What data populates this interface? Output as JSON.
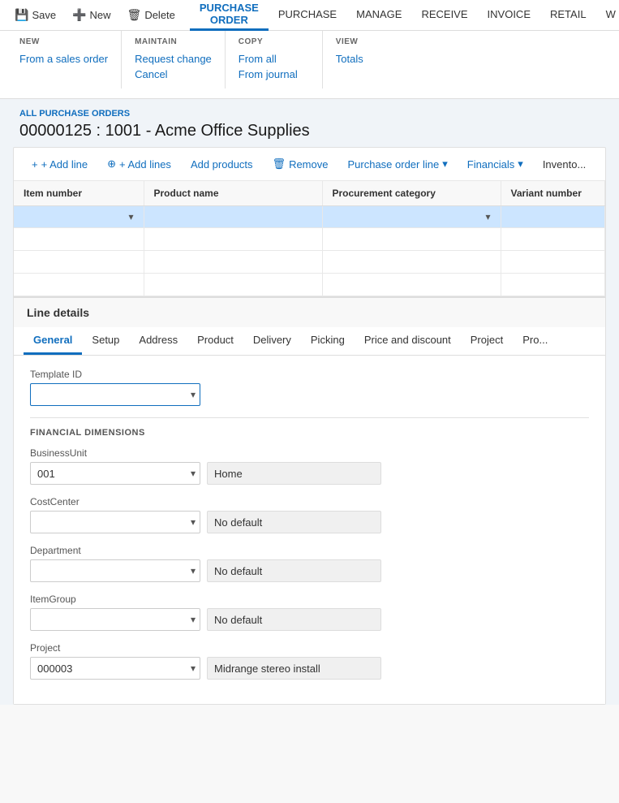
{
  "toolbar": {
    "save_label": "Save",
    "new_label": "New",
    "delete_label": "Delete",
    "tabs": [
      {
        "id": "purchase-order",
        "label": "PURCHASE ORDER",
        "active": true
      },
      {
        "id": "purchase",
        "label": "PURCHASE"
      },
      {
        "id": "manage",
        "label": "MANAGE"
      },
      {
        "id": "receive",
        "label": "RECEIVE"
      },
      {
        "id": "invoice",
        "label": "INVOICE"
      },
      {
        "id": "retail",
        "label": "RETAIL"
      },
      {
        "id": "w",
        "label": "W"
      }
    ]
  },
  "dropdown": {
    "new_section": {
      "title": "NEW",
      "items": [
        {
          "label": "From a sales order",
          "disabled": false
        }
      ]
    },
    "maintain_section": {
      "title": "MAINTAIN",
      "items": [
        {
          "label": "Request change",
          "disabled": false
        },
        {
          "label": "Cancel",
          "disabled": false
        }
      ]
    },
    "copy_section": {
      "title": "COPY",
      "items": [
        {
          "label": "From all",
          "disabled": false
        },
        {
          "label": "From journal",
          "disabled": false
        }
      ]
    },
    "view_section": {
      "title": "VIEW",
      "items": [
        {
          "label": "Totals",
          "disabled": false
        }
      ]
    }
  },
  "page_header": {
    "breadcrumb": "ALL PURCHASE ORDERS",
    "title": "00000125 : 1001 - Acme Office Supplies"
  },
  "grid_toolbar": {
    "add_line": "+ Add line",
    "add_lines": "+ Add lines",
    "add_products": "Add products",
    "remove": "Remove",
    "purchase_order_line": "Purchase order line",
    "financials": "Financials",
    "inventory": "Invento..."
  },
  "grid": {
    "columns": [
      {
        "id": "item-number",
        "label": "Item number"
      },
      {
        "id": "product-name",
        "label": "Product name"
      },
      {
        "id": "procurement-category",
        "label": "Procurement category"
      },
      {
        "id": "variant-number",
        "label": "Variant number"
      }
    ],
    "rows": []
  },
  "line_details": {
    "header": "Line details",
    "tabs": [
      {
        "id": "general",
        "label": "General",
        "active": true
      },
      {
        "id": "setup",
        "label": "Setup"
      },
      {
        "id": "address",
        "label": "Address"
      },
      {
        "id": "product",
        "label": "Product"
      },
      {
        "id": "delivery",
        "label": "Delivery"
      },
      {
        "id": "picking",
        "label": "Picking"
      },
      {
        "id": "price-and-discount",
        "label": "Price and discount"
      },
      {
        "id": "project",
        "label": "Project"
      },
      {
        "id": "more",
        "label": "Pro..."
      }
    ]
  },
  "form": {
    "template_id_label": "Template ID",
    "template_id_value": "",
    "financial_dimensions_title": "FINANCIAL DIMENSIONS",
    "business_unit_label": "BusinessUnit",
    "business_unit_value": "001",
    "business_unit_static": "Home",
    "cost_center_label": "CostCenter",
    "cost_center_value": "",
    "cost_center_static": "No default",
    "department_label": "Department",
    "department_value": "",
    "department_static": "No default",
    "item_group_label": "ItemGroup",
    "item_group_value": "",
    "item_group_static": "No default",
    "project_label": "Project",
    "project_value": "000003",
    "project_static": "Midrange stereo install"
  },
  "icons": {
    "save": "💾",
    "new": "➕",
    "delete": "🗑",
    "dropdown_arrow": "▾",
    "add_line": "+",
    "remove": "🗑"
  }
}
